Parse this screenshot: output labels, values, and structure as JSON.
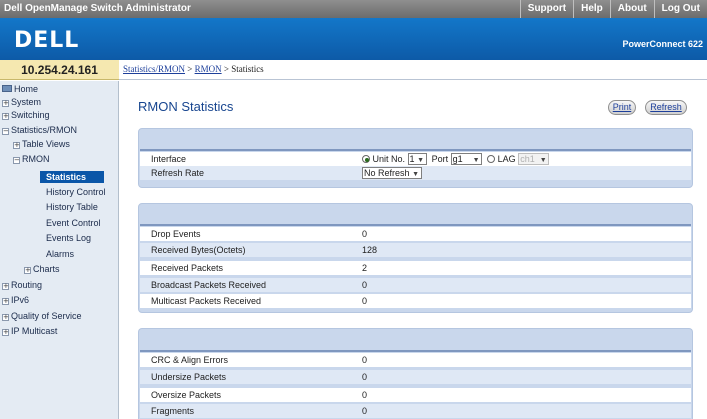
{
  "topbar": {
    "title": "Dell OpenManage Switch Administrator",
    "links": [
      "Support",
      "Help",
      "About",
      "Log Out"
    ]
  },
  "brand": {
    "logo": "DELL",
    "product": "PowerConnect 622"
  },
  "ip_address": "10.254.24.161",
  "breadcrumb": {
    "link1": "Statistics/RMON",
    "sep1": " > ",
    "link2": "RMON",
    "sep2": " > ",
    "current": "Statistics"
  },
  "sidebar": {
    "items": [
      {
        "label": "Home",
        "icon": "home-icon"
      },
      {
        "label": "System",
        "expander": "+"
      },
      {
        "label": "Switching",
        "expander": "+"
      },
      {
        "label": "Statistics/RMON",
        "expander": "−"
      },
      {
        "label": "Table Views",
        "expander": "+"
      },
      {
        "label": "RMON",
        "expander": "−"
      },
      {
        "label": "Statistics"
      },
      {
        "label": "History Control"
      },
      {
        "label": "History Table"
      },
      {
        "label": "Event Control"
      },
      {
        "label": "Events Log"
      },
      {
        "label": "Alarms"
      },
      {
        "label": "Charts",
        "expander": "+"
      },
      {
        "label": "Routing",
        "expander": "+"
      },
      {
        "label": "IPv6",
        "expander": "+"
      },
      {
        "label": "Quality of Service",
        "expander": "+"
      },
      {
        "label": "IP Multicast",
        "expander": "+"
      }
    ]
  },
  "page": {
    "title": "RMON Statistics",
    "print_label": "Print",
    "refresh_label": "Refresh"
  },
  "form": {
    "interface_label": "Interface",
    "unit_label": "Unit No.",
    "unit_value": "1",
    "port_label": "Port",
    "port_value": "g1",
    "lag_label": "LAG",
    "lag_value": "ch1",
    "refresh_rate_label": "Refresh Rate",
    "refresh_rate_value": "No Refresh"
  },
  "stats1": [
    {
      "label": "Drop Events",
      "value": "0"
    },
    {
      "label": "Received Bytes(Octets)",
      "value": "128"
    },
    {
      "label": "Received Packets",
      "value": "2"
    },
    {
      "label": "Broadcast Packets Received",
      "value": "0"
    },
    {
      "label": "Multicast Packets Received",
      "value": "0"
    }
  ],
  "stats2": [
    {
      "label": "CRC & Align Errors",
      "value": "0"
    },
    {
      "label": "Undersize Packets",
      "value": "0"
    },
    {
      "label": "Oversize Packets",
      "value": "0"
    },
    {
      "label": "Fragments",
      "value": "0"
    }
  ]
}
